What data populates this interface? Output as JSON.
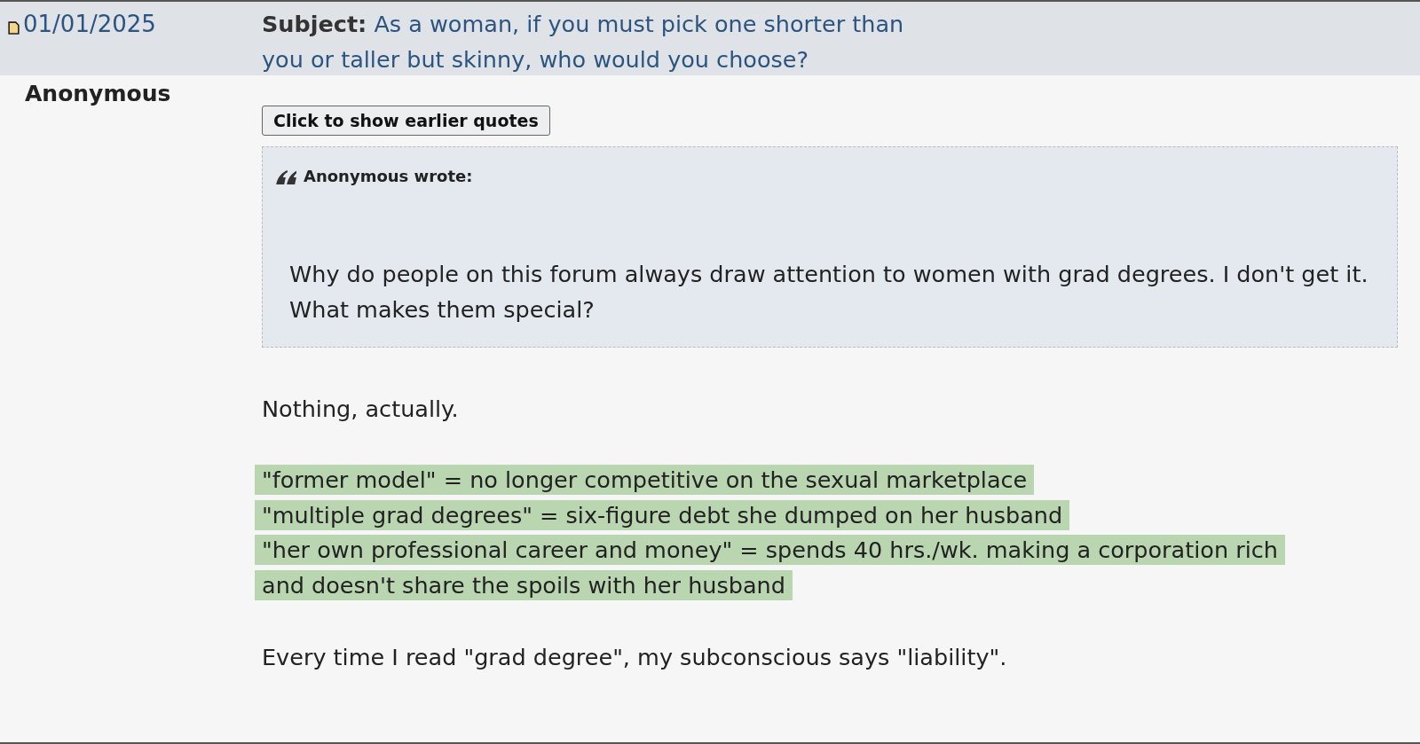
{
  "post": {
    "date": "01/01/2025",
    "subject_label": "Subject:",
    "subject": "As a woman, if you must pick one shorter than you or taller but skinny, who would you choose?",
    "author": "Anonymous",
    "show_quotes_button": "Click to show earlier quotes",
    "quote": {
      "author_line": "Anonymous wrote:",
      "text": "Why do people on this forum always draw attention to women with grad degrees. I don't get it. What makes them special?"
    },
    "body": [
      {
        "kind": "paragraph",
        "text": "Nothing, actually."
      },
      {
        "kind": "highlight",
        "lines": [
          "\"former model\" = no longer competitive on the sexual marketplace",
          "\"multiple grad degrees\" = six-figure debt she dumped on her husband",
          "\"her own professional career and money\" = spends 40 hrs./wk. making a corporation rich",
          "and doesn't share the spoils with her husband"
        ]
      },
      {
        "kind": "paragraph",
        "text": "Every time I read \"grad degree\", my subconscious says \"liability\"."
      }
    ]
  }
}
